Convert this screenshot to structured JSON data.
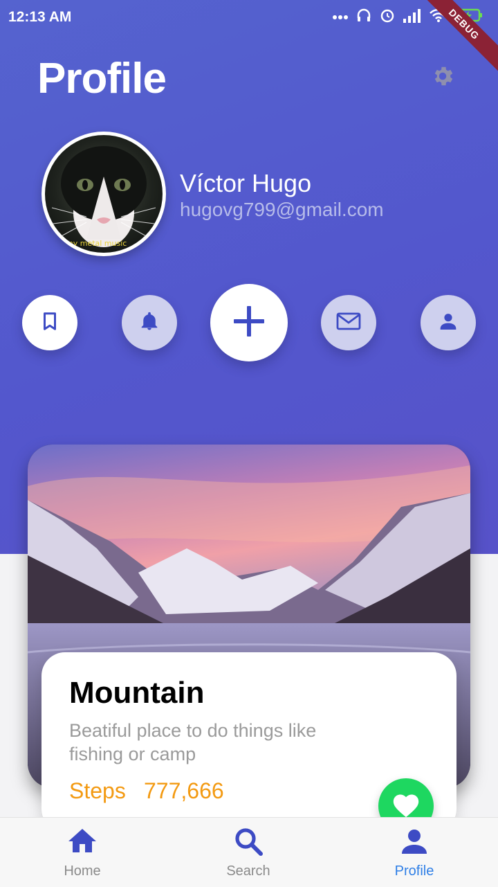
{
  "status": {
    "time": "12:13 AM",
    "debug": "DEBUG"
  },
  "header": {
    "title": "Profile",
    "settings_icon": "gear-icon"
  },
  "user": {
    "name": "Víctor Hugo",
    "email": "hugovg799@gmail.com",
    "avatar_caption": "my metal music"
  },
  "actions": [
    {
      "icon": "bookmark-icon"
    },
    {
      "icon": "bell-icon"
    },
    {
      "icon": "plus-icon"
    },
    {
      "icon": "mail-icon"
    },
    {
      "icon": "person-icon"
    }
  ],
  "card": {
    "title": "Mountain",
    "description": "Beatiful place to do things like fishing or camp",
    "steps_label": "Steps",
    "steps_value": "777,666",
    "favorite_icon": "heart-icon"
  },
  "nav": [
    {
      "label": "Home",
      "icon": "home-icon"
    },
    {
      "label": "Search",
      "icon": "search-icon"
    },
    {
      "label": "Profile",
      "icon": "person-icon"
    }
  ],
  "colors": {
    "hero": "#5357cd",
    "accent": "#3d4bc4",
    "steps": "#f39a12",
    "favorite": "#1ed760",
    "nav_active": "#2f7fe6",
    "nav_inactive": "#8a8a8a"
  }
}
